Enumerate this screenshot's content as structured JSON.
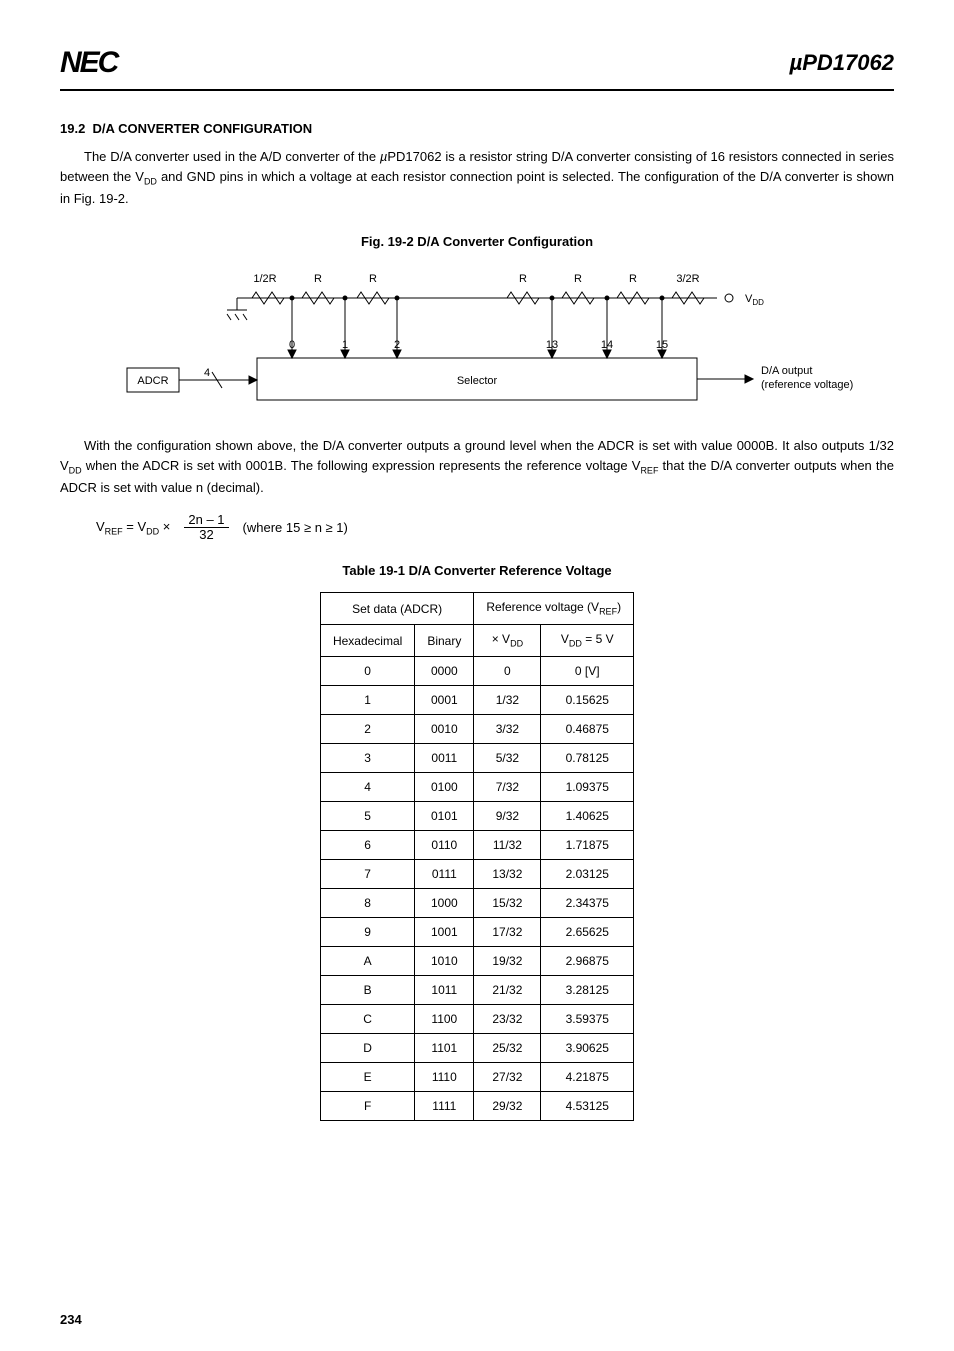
{
  "header": {
    "logo": "NEC",
    "product_prefix": "µ",
    "product": "PD17062"
  },
  "section": {
    "number": "19.2",
    "title": "D/A CONVERTER CONFIGURATION",
    "para1_a": "The D/A converter used in the A/D converter of the ",
    "para1_b": "µ",
    "para1_c": "PD17062 is a resistor string D/A converter consisting of 16 resistors connected in series between the V",
    "para1_d": " and GND pins in which a voltage at each resistor connection point is selected.  The configuration of the D/A converter is shown in Fig. 19-2.",
    "vdd_sub": "DD"
  },
  "fig": {
    "caption": "Fig. 19-2   D/A Converter Configuration"
  },
  "diagram": {
    "r_half": "1/2R",
    "r": "R",
    "r_32": "3/2R",
    "vdd": "V",
    "vdd_sub": "DD",
    "tap0": "0",
    "tap1": "1",
    "tap2": "2",
    "tap13": "13",
    "tap14": "14",
    "tap15": "15",
    "adcr": "ADCR",
    "adcr_w": "4",
    "selector": "Selector",
    "out1": "D/A output",
    "out2": "(reference voltage)"
  },
  "para2": {
    "a": "With the configuration shown above, the D/A converter outputs a ground level when the ADCR is set with value 0000B.  It also outputs 1/32 ",
    "x": "×",
    "b": " V",
    "c": " when the ADCR is set with 0001B.  The following expression represents the reference voltage V",
    "ref_sub": "REF",
    "d": " that the D/A converter outputs when the ADCR is set with value n (decimal)."
  },
  "formula": {
    "lhs_a": "V",
    "lhs_ref": "REF",
    "eq": " = V",
    "lhs_dd": "DD",
    "times": " × ",
    "top": "2n – 1",
    "bot": "32",
    "where": " (where 15 ≥ n ≥ 1)"
  },
  "table": {
    "caption": "Table 19-1   D/A Converter Reference Voltage",
    "h_set": "Set data (ADCR)",
    "h_ref_a": "Reference voltage (V",
    "h_ref_sub": "REF",
    "h_ref_b": ")",
    "h_hex": "Hexadecimal",
    "h_bin": "Binary",
    "h_xvdd_a": "× V",
    "h_xvdd_sub": "DD",
    "h_vdd5_a": "V",
    "h_vdd5_sub": "DD",
    "h_vdd5_b": " = 5 V",
    "rows": [
      {
        "hex": "0",
        "bin": "0000",
        "xvdd": "0",
        "v": "0 [V]"
      },
      {
        "hex": "1",
        "bin": "0001",
        "xvdd": "1/32",
        "v": "0.15625"
      },
      {
        "hex": "2",
        "bin": "0010",
        "xvdd": "3/32",
        "v": "0.46875"
      },
      {
        "hex": "3",
        "bin": "0011",
        "xvdd": "5/32",
        "v": "0.78125"
      },
      {
        "hex": "4",
        "bin": "0100",
        "xvdd": "7/32",
        "v": "1.09375"
      },
      {
        "hex": "5",
        "bin": "0101",
        "xvdd": "9/32",
        "v": "1.40625"
      },
      {
        "hex": "6",
        "bin": "0110",
        "xvdd": "11/32",
        "v": "1.71875"
      },
      {
        "hex": "7",
        "bin": "0111",
        "xvdd": "13/32",
        "v": "2.03125"
      },
      {
        "hex": "8",
        "bin": "1000",
        "xvdd": "15/32",
        "v": "2.34375"
      },
      {
        "hex": "9",
        "bin": "1001",
        "xvdd": "17/32",
        "v": "2.65625"
      },
      {
        "hex": "A",
        "bin": "1010",
        "xvdd": "19/32",
        "v": "2.96875"
      },
      {
        "hex": "B",
        "bin": "1011",
        "xvdd": "21/32",
        "v": "3.28125"
      },
      {
        "hex": "C",
        "bin": "1100",
        "xvdd": "23/32",
        "v": "3.59375"
      },
      {
        "hex": "D",
        "bin": "1101",
        "xvdd": "25/32",
        "v": "3.90625"
      },
      {
        "hex": "E",
        "bin": "1110",
        "xvdd": "27/32",
        "v": "4.21875"
      },
      {
        "hex": "F",
        "bin": "1111",
        "xvdd": "29/32",
        "v": "4.53125"
      }
    ]
  },
  "page": "234"
}
